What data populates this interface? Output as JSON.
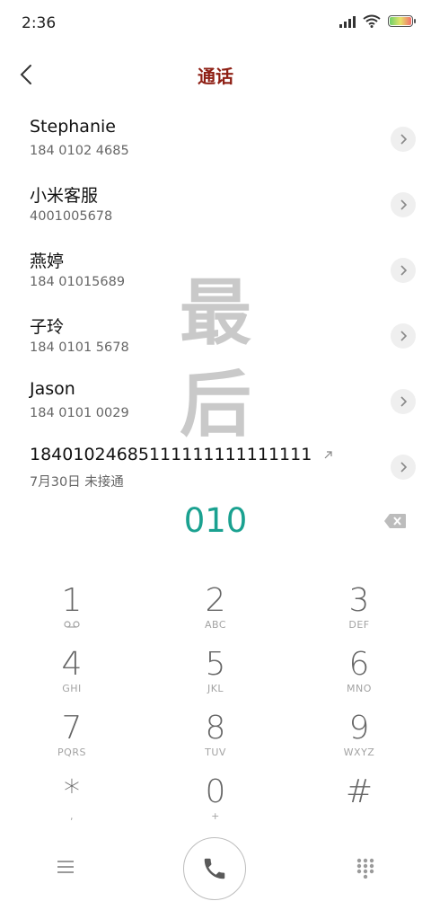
{
  "status": {
    "time": "2:36"
  },
  "header": {
    "title": "通话"
  },
  "contacts": [
    {
      "name": "Stephanie",
      "detail": "184 0102 4685"
    },
    {
      "name": "小米客服",
      "detail": "4001005678"
    },
    {
      "name": "燕婷",
      "detail": "184 01015689"
    },
    {
      "name": "子玲",
      "detail": "184 0101 5678"
    },
    {
      "name": "Jason",
      "detail": "184 0101 0029"
    },
    {
      "name": "18401024685111111111111111",
      "detail": "7月30日 未接通"
    }
  ],
  "watermark": {
    "line1": "最",
    "line2": "后"
  },
  "dialed_number": "010",
  "keypad": [
    {
      "digit": "1",
      "letters": ""
    },
    {
      "digit": "2",
      "letters": "ABC"
    },
    {
      "digit": "3",
      "letters": "DEF"
    },
    {
      "digit": "4",
      "letters": "GHI"
    },
    {
      "digit": "5",
      "letters": "JKL"
    },
    {
      "digit": "6",
      "letters": "MNO"
    },
    {
      "digit": "7",
      "letters": "PQRS"
    },
    {
      "digit": "8",
      "letters": "TUV"
    },
    {
      "digit": "9",
      "letters": "WXYZ"
    },
    {
      "digit": "*",
      "letters": ","
    },
    {
      "digit": "0",
      "letters": "+"
    },
    {
      "digit": "#",
      "letters": ""
    }
  ],
  "icons": {
    "status": [
      "signal-icon",
      "wifi-icon",
      "battery-icon"
    ],
    "back": "back-arrow-icon",
    "row_action": "chevron-right-icon",
    "backspace": "backspace-icon",
    "voicemail": "voicemail-icon",
    "menu": "menu-icon",
    "call": "phone-icon",
    "dialpad": "dialpad-icon"
  },
  "colors": {
    "title": "#8e1f14",
    "dialed": "#1aa190"
  }
}
